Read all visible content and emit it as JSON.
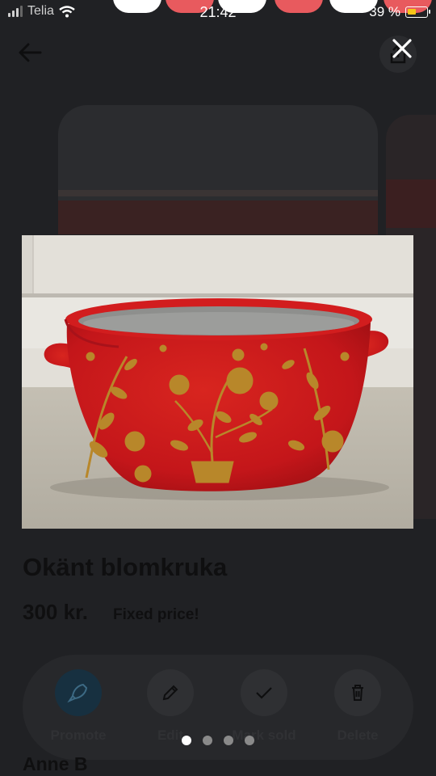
{
  "status_bar": {
    "carrier": "Telia",
    "time": "21:42",
    "battery": "39 %"
  },
  "listing": {
    "title": "Okänt blomkruka",
    "price": "300 kr.",
    "price_note": "Fixed price!",
    "seller": "Anne B"
  },
  "actions": [
    {
      "label": "Promote",
      "icon": "rocket-icon"
    },
    {
      "label": "Edit",
      "icon": "pencil-icon"
    },
    {
      "label": "Mark sold",
      "icon": "checkmark-icon"
    },
    {
      "label": "Delete",
      "icon": "trash-icon"
    }
  ],
  "gallery": {
    "photo_count": 4,
    "current_index": 1
  },
  "colors": {
    "backdrop": "#202124",
    "pot_red": "#c8161b",
    "pot_gold": "#b8872a"
  }
}
